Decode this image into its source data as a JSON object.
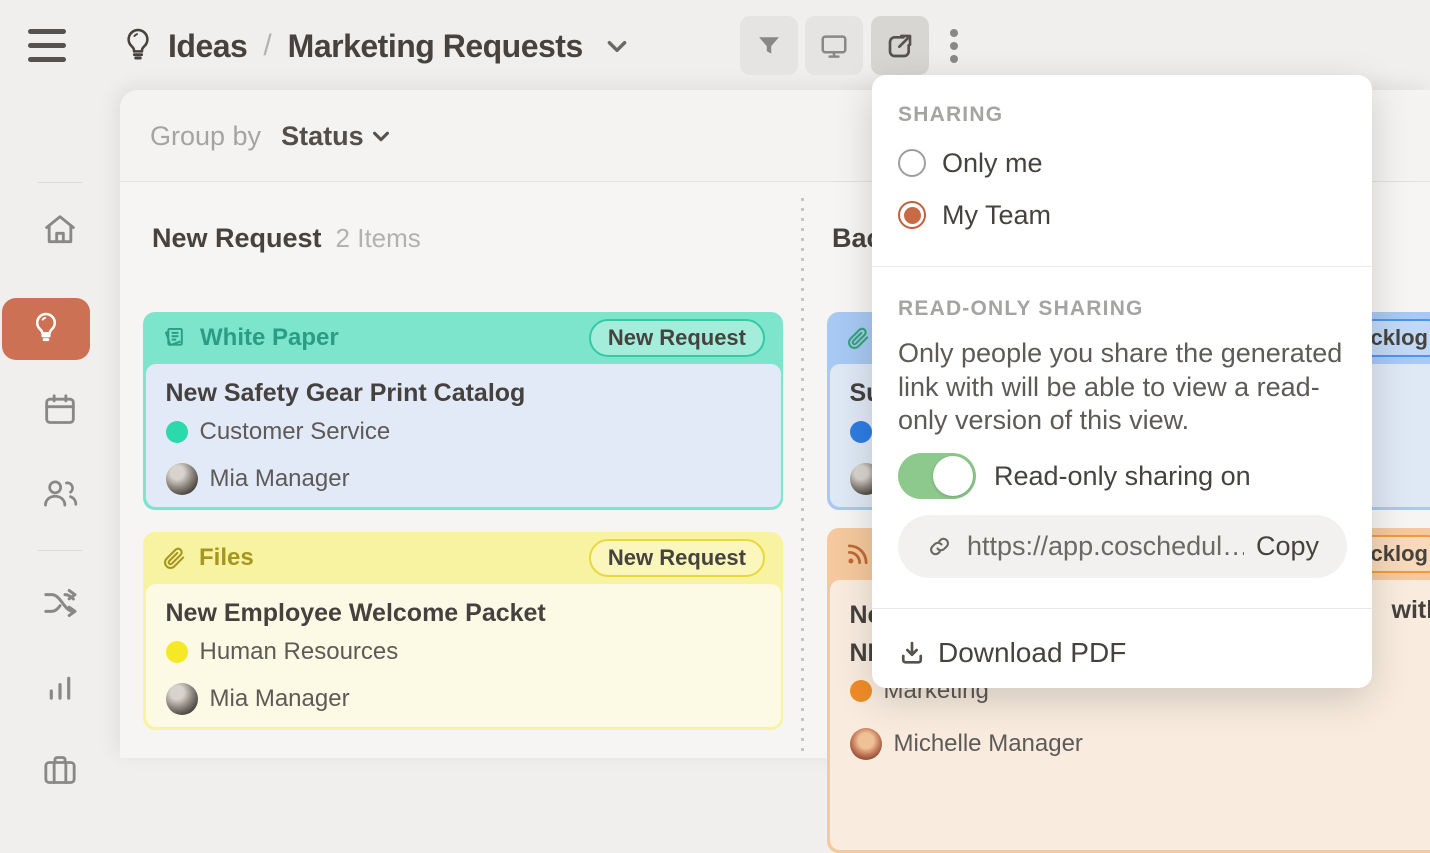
{
  "colors": {
    "sidebar_active": "#cc7154",
    "teal_header": "#7de5cc",
    "teal_text": "#2a9d84",
    "teal_dot": "#2bd9ac",
    "yellow_header": "#f8f3a0",
    "yellow_text": "#a59620",
    "yellow_dot": "#f5e926",
    "blue_header": "#a7c9f3",
    "blue_dot": "#2e7de2",
    "orange_header": "#f5c99d",
    "orange_dot": "#f08c28",
    "toggle_green": "#8dc88c",
    "radio_selected": "#c96a47"
  },
  "topbar": {
    "breadcrumb_section": "Ideas",
    "breadcrumb_separator": "/",
    "breadcrumb_page": "Marketing Requests"
  },
  "board": {
    "group_by_label": "Group by",
    "group_by_value": "Status",
    "columns": [
      {
        "title": "New Request",
        "count": "2 Items"
      },
      {
        "title": "Backlog",
        "count": ""
      }
    ],
    "cards": [
      {
        "type": "White Paper",
        "type_icon": "document-stack-icon",
        "badge": "New Request",
        "title": "New Safety Gear Print Catalog",
        "category": "Customer Service",
        "assignee": "Mia Manager"
      },
      {
        "type": "Files",
        "type_icon": "paperclip-icon",
        "badge": "New Request",
        "title": "New Employee Welcome Packet",
        "category": "Human Resources",
        "assignee": "Mia Manager"
      },
      {
        "type_icon": "paperclip-icon",
        "badge": "Backlog",
        "title_fragment": "Su"
      },
      {
        "type_icon": "rss-icon",
        "badge": "Backlog",
        "title_fragment_start": "Ne",
        "title_fragment_end": "with",
        "title_fragment_line2": "NP",
        "category": "Marketing",
        "assignee": "Michelle Manager"
      }
    ]
  },
  "popover": {
    "sharing_header": "SHARING",
    "options": [
      {
        "label": "Only me",
        "selected": false
      },
      {
        "label": "My Team",
        "selected": true
      }
    ],
    "readonly_header": "READ-ONLY SHARING",
    "readonly_description": "Only people you share the generated link with will be able to view a read-only version of this view.",
    "toggle_label": "Read-only sharing on",
    "link_url": "https://app.coschedul…",
    "copy_label": "Copy",
    "download_label": "Download PDF"
  }
}
